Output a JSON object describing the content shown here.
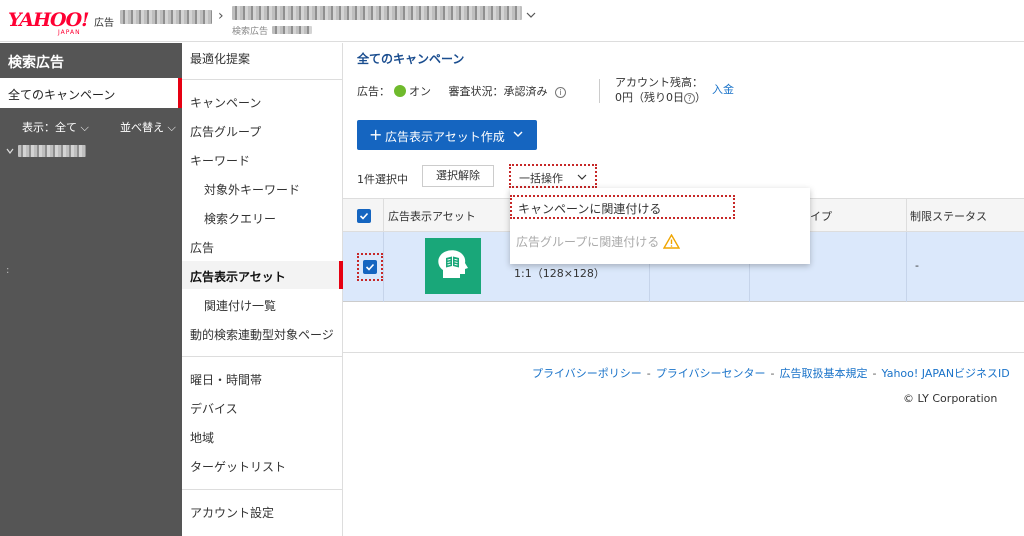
{
  "header": {
    "logo": "YAHOO!",
    "logo_sub": "JAPAN",
    "logo_suffix": "広告",
    "breadcrumb_sub": "検索広告"
  },
  "sidebar": {
    "title": "検索広告",
    "all_campaigns": "全てのキャンペーン",
    "filter": "表示：全て",
    "sort": "並べ替え"
  },
  "nav": {
    "items": [
      {
        "label": "最適化提案"
      },
      {
        "label": "キャンペーン"
      },
      {
        "label": "広告グループ"
      },
      {
        "label": "キーワード"
      },
      {
        "label": "対象外キーワード"
      },
      {
        "label": "検索クエリー"
      },
      {
        "label": "広告"
      },
      {
        "label": "広告表示アセット"
      },
      {
        "label": "関連付け一覧"
      },
      {
        "label": "動的検索連動型対象ページ"
      },
      {
        "label": "曜日・時間帯"
      },
      {
        "label": "デバイス"
      },
      {
        "label": "地域"
      },
      {
        "label": "ターゲットリスト"
      },
      {
        "label": "アカウント設定"
      }
    ]
  },
  "main": {
    "title": "全てのキャンペーン",
    "ad_label": "広告：",
    "ad_status": "オン",
    "review_status": "審査状況：承認済み",
    "balance_label": "アカウント残高：",
    "balance_value": "0円（残り0日",
    "balance_close": "）",
    "deposit": "入金",
    "create_button": "広告表示アセット作成",
    "selected_count": "1件選択中",
    "clear_selection": "選択解除",
    "bulk_action": "一括操作",
    "table": {
      "col_asset": "広告表示アセット",
      "col_type": "イプ",
      "col_restrict": "制限ステータス",
      "row": {
        "size": "1:1（128×128）",
        "restrict": "-"
      }
    },
    "dropdown": {
      "link_campaign": "キャンペーンに関連付ける",
      "link_adgroup": "広告グループに関連付ける"
    }
  },
  "footer": {
    "privacy_policy": "プライバシーポリシー",
    "privacy_center": "プライバシーセンター",
    "terms": "広告取扱基本規定",
    "business_id": "Yahoo! JAPANビジネスID",
    "copyright": "© LY Corporation"
  },
  "colors": {
    "brand_red": "#ff0033",
    "primary_blue": "#1565c0",
    "highlight_red": "#c62828",
    "asset_green": "#19a779"
  }
}
